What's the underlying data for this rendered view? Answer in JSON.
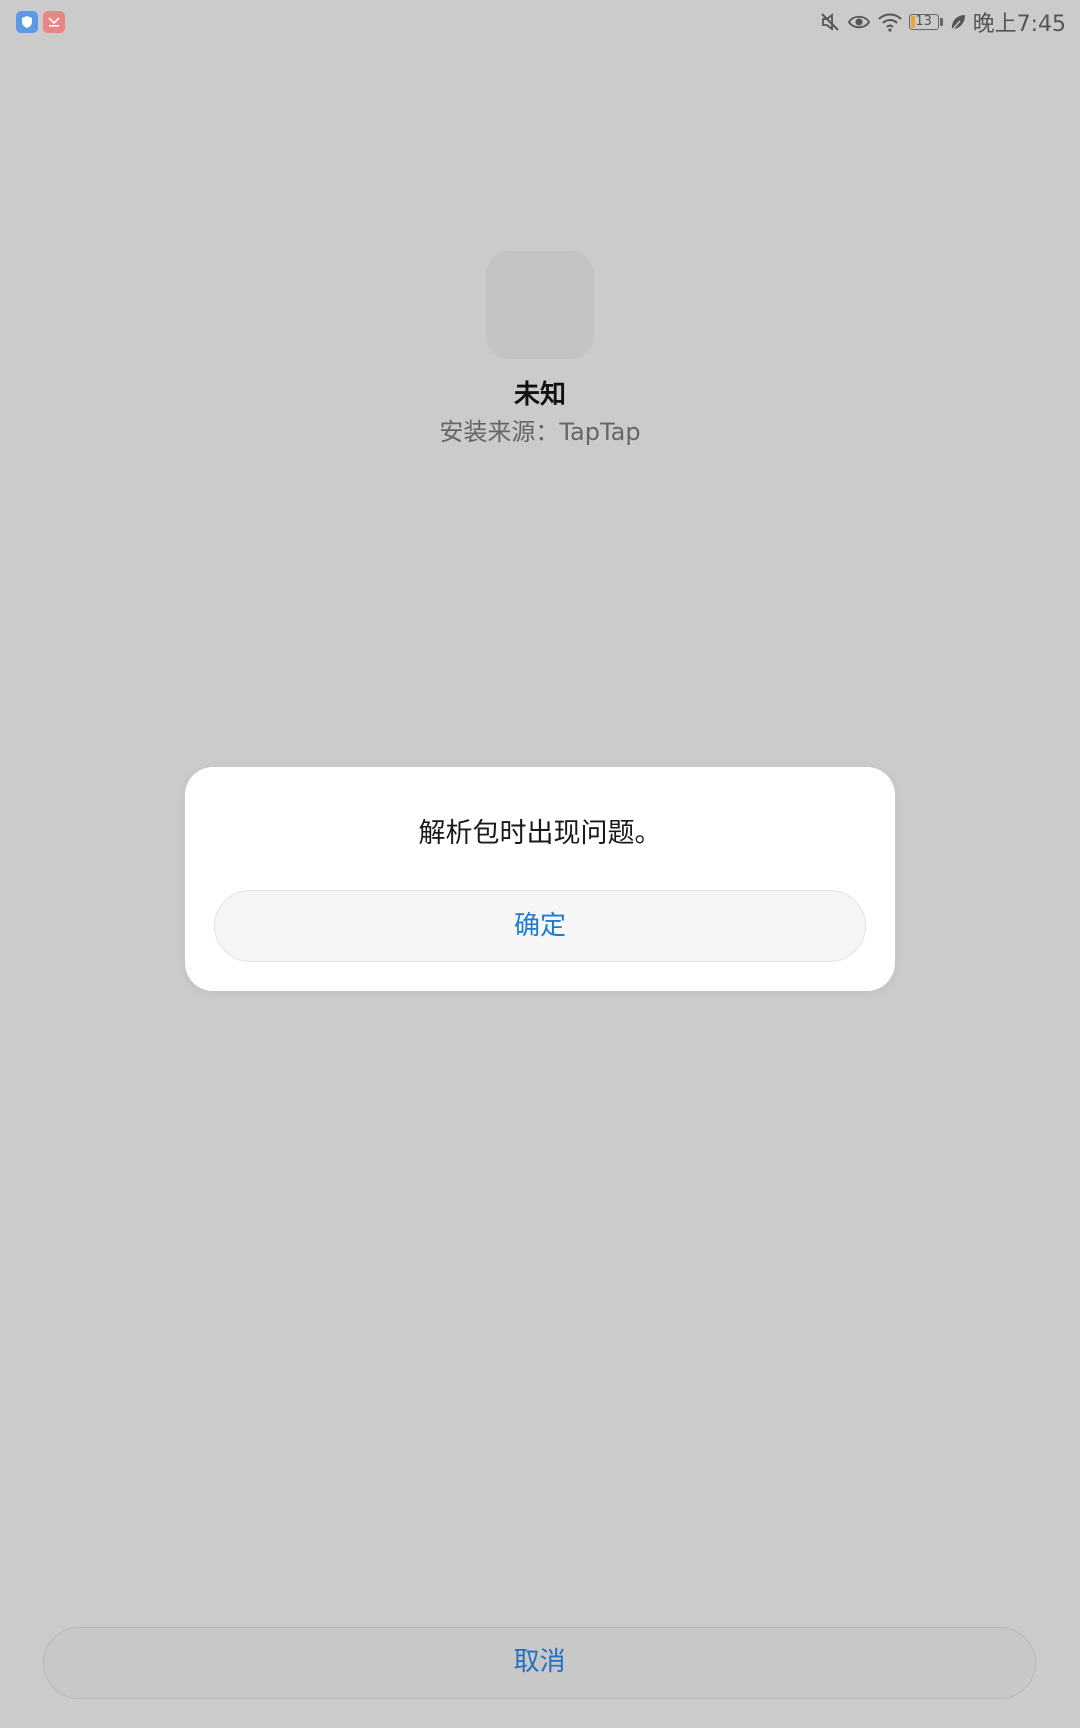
{
  "status_bar": {
    "left_icons": [
      "shield-app-icon",
      "mail-app-icon"
    ],
    "right_icons": [
      "mute-icon",
      "eye-icon",
      "wifi-icon",
      "battery-icon",
      "leaf-icon"
    ],
    "battery_level": "13",
    "time": "晚上7:45"
  },
  "app": {
    "name": "未知",
    "source": "安装来源：TapTap"
  },
  "dialog": {
    "message": "解析包时出现问题。",
    "ok_label": "确定"
  },
  "footer": {
    "cancel_label": "取消"
  },
  "colors": {
    "background": "#cbcbcb",
    "accent": "#1f7ad4",
    "dialog": "#ffffff",
    "battery_fill": "#e8a23a"
  }
}
